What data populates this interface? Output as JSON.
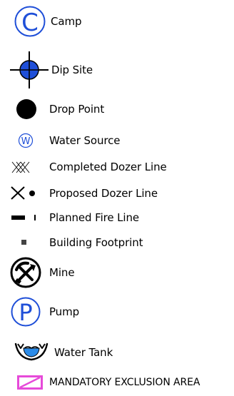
{
  "legend": {
    "items": [
      {
        "label": "Camp",
        "icon": "camp-c-circle-icon"
      },
      {
        "label": "Dip Site",
        "icon": "crosshair-dot-icon"
      },
      {
        "label": "Drop Point",
        "icon": "filled-circle-icon"
      },
      {
        "label": "Water Source",
        "icon": "w-circle-icon"
      },
      {
        "label": "Completed Dozer Line",
        "icon": "cross-hatch-icon"
      },
      {
        "label": "Proposed Dozer Line",
        "icon": "x-dot-icon"
      },
      {
        "label": "Planned Fire Line",
        "icon": "dash-line-icon"
      },
      {
        "label": "Building Footprint",
        "icon": "small-square-icon"
      },
      {
        "label": "Mine",
        "icon": "pick-shovel-circle-icon"
      },
      {
        "label": "Pump",
        "icon": "p-circle-icon"
      },
      {
        "label": "Water Tank",
        "icon": "water-tank-icon"
      },
      {
        "label": "MANDATORY EXCLUSION AREA",
        "icon": "exclusion-rect-icon"
      }
    ],
    "colors": {
      "accent_blue": "#1f4fd8",
      "tank_fill": "#2b8be8",
      "exclusion_magenta": "#e64ad9",
      "black": "#000000"
    }
  }
}
